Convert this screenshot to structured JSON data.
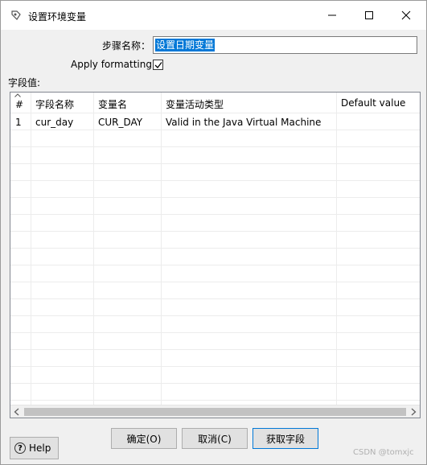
{
  "window": {
    "title": "设置环境变量"
  },
  "form": {
    "step_name_label": "步骤名称：",
    "step_name_value": "设置日期变量",
    "apply_formatting_label": "Apply formatting",
    "apply_formatting_checked": true,
    "fields_label": "字段值:"
  },
  "table": {
    "columns": [
      "#",
      "字段名称",
      "变量名",
      "变量活动类型",
      "Default value"
    ],
    "rows": [
      {
        "num": "1",
        "field": "cur_day",
        "variable": "CUR_DAY",
        "type": "Valid in the Java Virtual Machine",
        "default": ""
      }
    ]
  },
  "buttons": {
    "ok": "确定(O)",
    "cancel": "取消(C)",
    "get_fields": "获取字段",
    "help": "Help"
  },
  "watermark": "CSDN @tomxjc"
}
